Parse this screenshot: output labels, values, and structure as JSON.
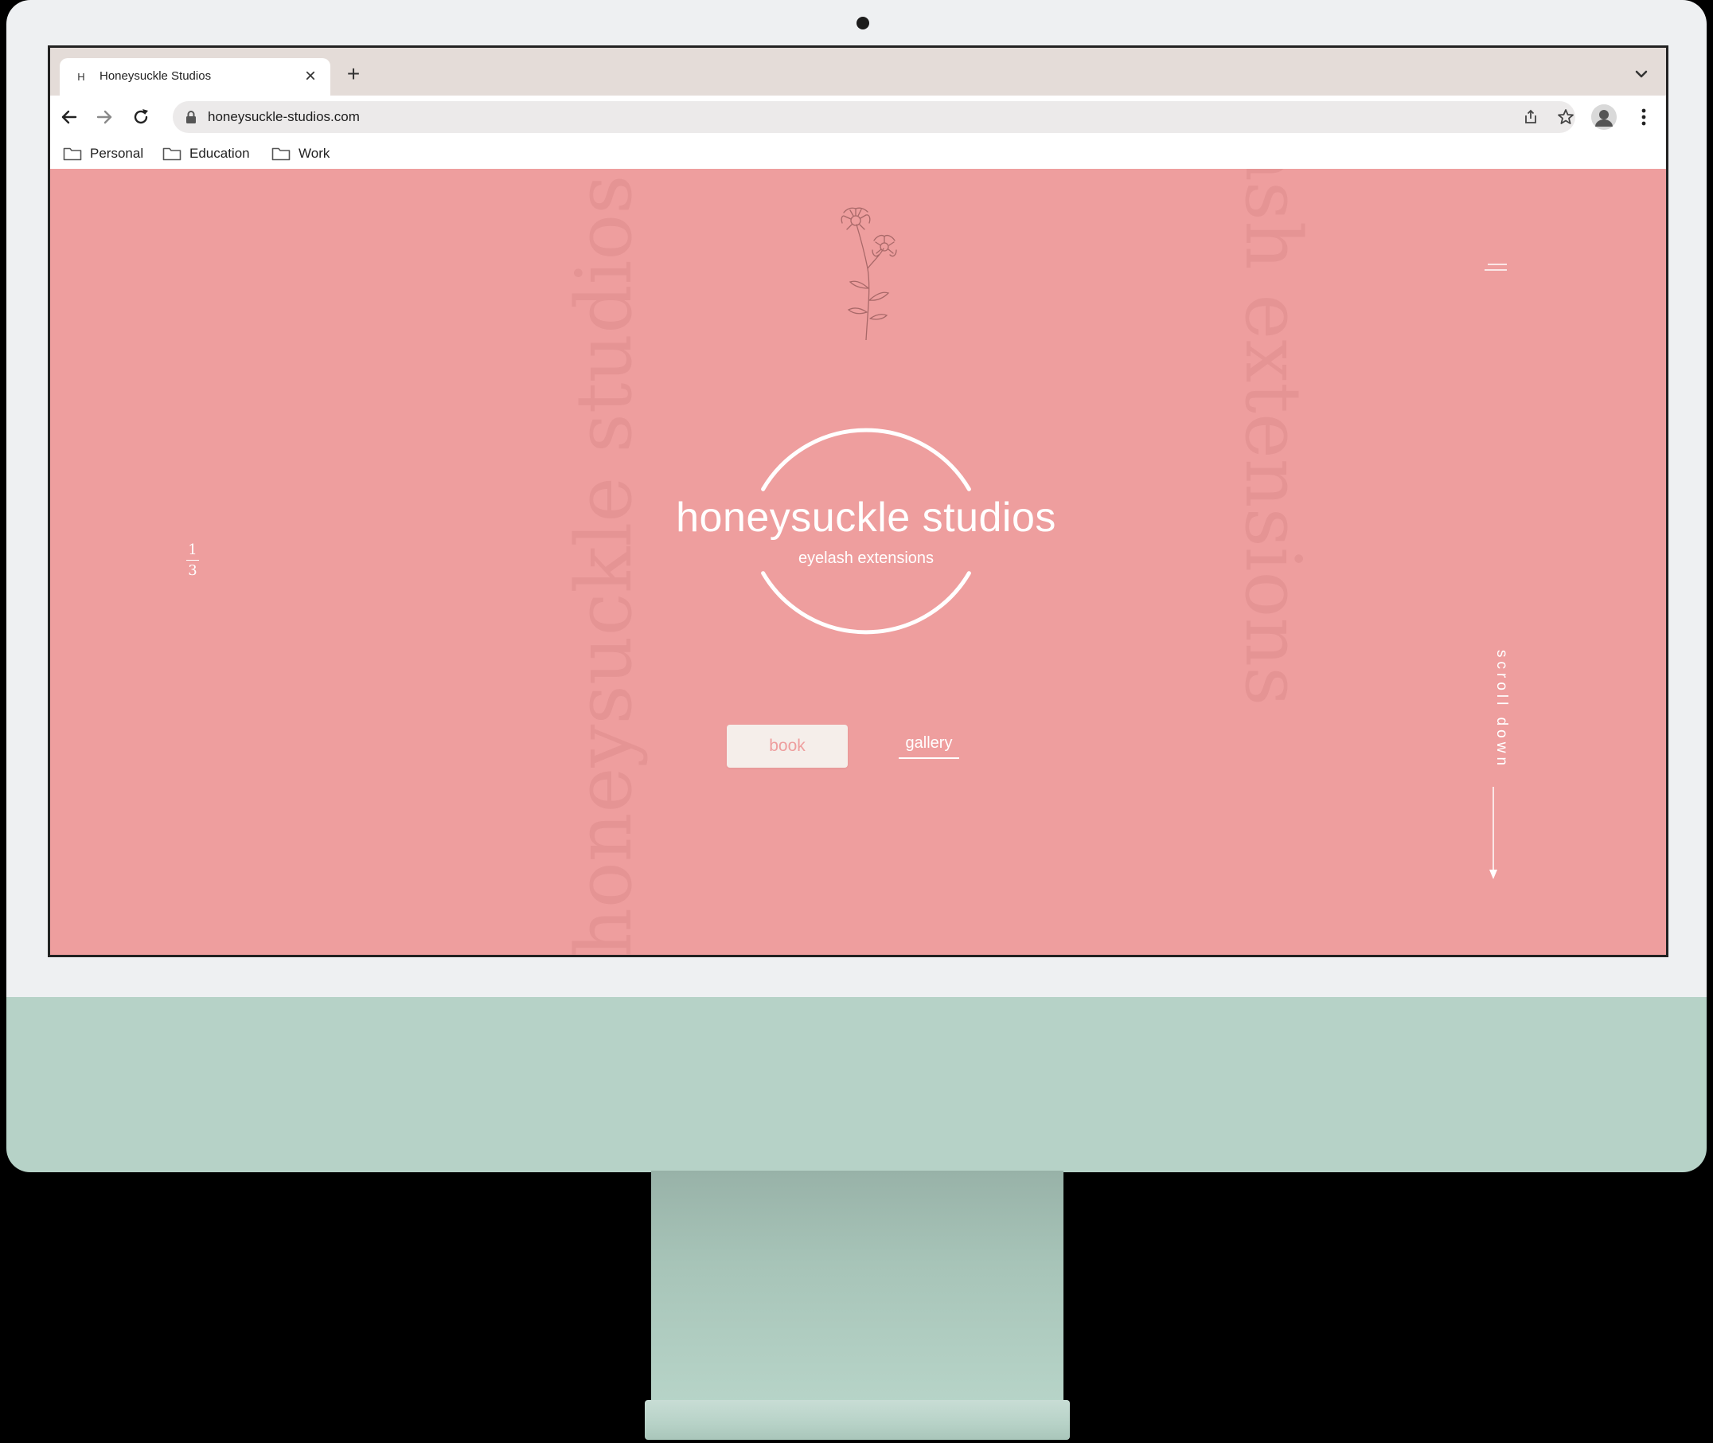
{
  "browser": {
    "tab": {
      "favicon": "H",
      "title": "Honeysuckle Studios",
      "close_icon": "close-icon"
    },
    "new_tab_icon": "plus-icon",
    "url": "honeysuckle-studios.com",
    "bookmarks": [
      {
        "label": "Personal",
        "icon": "folder-icon"
      },
      {
        "label": "Education",
        "icon": "folder-icon"
      },
      {
        "label": "Work",
        "icon": "folder-icon"
      }
    ]
  },
  "site": {
    "brand_title": "honeysuckle studios",
    "brand_subtitle": "eyelash extensions",
    "book_label": "book",
    "gallery_label": "gallery",
    "scroll_label": "scroll down",
    "slide_current": "1",
    "slide_total": "3",
    "ghost_left": "honeysuckle studios",
    "ghost_right": "eyelash extensions",
    "colors": {
      "background": "#ee9e9e",
      "ghost_text": "#e59494",
      "button_bg": "#f5eeea",
      "chin": "#b6d2c7"
    }
  }
}
